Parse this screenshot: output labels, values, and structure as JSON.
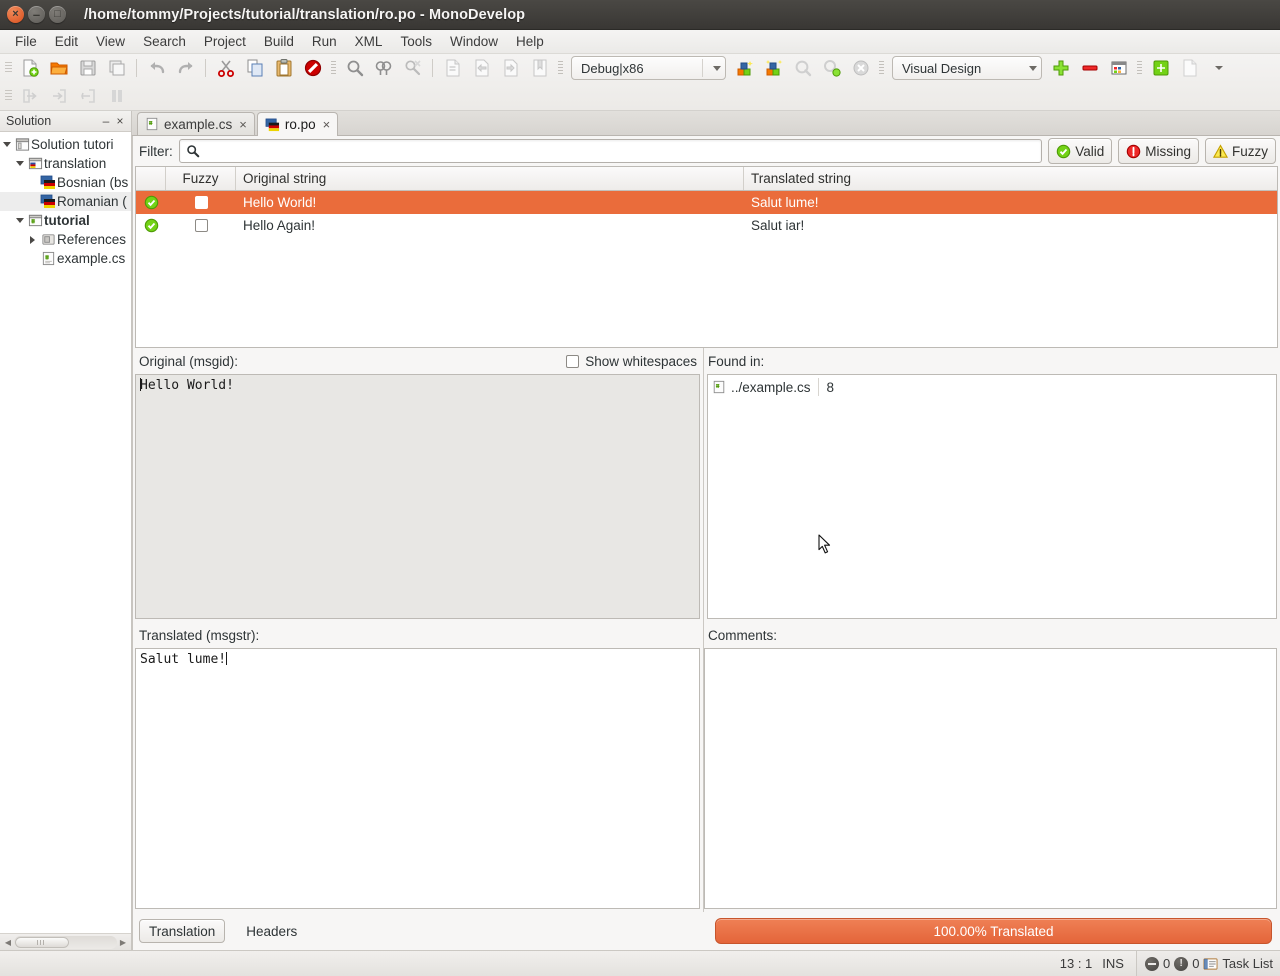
{
  "window": {
    "title": "/home/tommy/Projects/tutorial/translation/ro.po - MonoDevelop",
    "close_label": "×",
    "minimize_label": "–",
    "maximize_label": "□"
  },
  "menubar": {
    "items": [
      "File",
      "Edit",
      "View",
      "Search",
      "Project",
      "Build",
      "Run",
      "XML",
      "Tools",
      "Window",
      "Help"
    ]
  },
  "toolbar": {
    "icons_row1": [
      "new-file-icon",
      "open-file-icon",
      "save-icon",
      "save-all-icon",
      "undo-icon",
      "redo-icon",
      "cut-icon",
      "copy-icon",
      "paste-icon",
      "stop-icon",
      "find-icon",
      "find-replace-icon",
      "clear-search-icon",
      "comment-icon",
      "uncomment-icon",
      "indent-icon",
      "bookmark-icon"
    ],
    "icons_row2": [
      "step-out-icon",
      "step-over-icon",
      "step-into-icon",
      "pause-icon"
    ],
    "configuration": "Debug|x86",
    "build_icons": [
      "build-icon",
      "rebuild-icon",
      "run-icon",
      "run-with-icon",
      "stop-debug-icon"
    ],
    "view_mode": "Visual Design",
    "right_icons": [
      "add-icon",
      "remove-icon",
      "grid-icon",
      "properties-icon",
      "document-outline-icon",
      "overflow-arrow-icon"
    ]
  },
  "sidebar": {
    "title": "Solution",
    "minimize_label": "–",
    "close_label": "×",
    "items": [
      {
        "label": "Solution tutori",
        "icon": "solution-icon",
        "indent": 0,
        "expander": "open",
        "bold": false,
        "selected": false
      },
      {
        "label": "translation",
        "icon": "translation-project-icon",
        "indent": 1,
        "expander": "open",
        "bold": false,
        "selected": false
      },
      {
        "label": "Bosnian (bs",
        "icon": "flag-icon",
        "indent": 2,
        "expander": "none",
        "bold": false,
        "selected": false
      },
      {
        "label": "Romanian (",
        "icon": "flag-icon",
        "indent": 2,
        "expander": "none",
        "bold": false,
        "selected": true
      },
      {
        "label": "tutorial",
        "icon": "csharp-project-icon",
        "indent": 1,
        "expander": "open",
        "bold": true,
        "selected": false
      },
      {
        "label": "References",
        "icon": "references-icon",
        "indent": 2,
        "expander": "closed",
        "bold": false,
        "selected": false
      },
      {
        "label": "example.cs",
        "icon": "csharp-file-icon",
        "indent": 2,
        "expander": "none",
        "bold": false,
        "selected": false
      }
    ]
  },
  "tabs": [
    {
      "label": "example.cs",
      "icon": "csharp-file-icon",
      "active": false,
      "close": "×"
    },
    {
      "label": "ro.po",
      "icon": "flag-icon",
      "active": true,
      "close": "×"
    }
  ],
  "filter": {
    "label": "Filter:",
    "value": "",
    "placeholder": "",
    "search_icon": "search-icon",
    "buttons": [
      {
        "label": "Valid",
        "icon": "valid-icon",
        "color": "#4e9a06"
      },
      {
        "label": "Missing",
        "icon": "missing-icon",
        "color": "#cc0000"
      },
      {
        "label": "Fuzzy",
        "icon": "fuzzy-icon",
        "color": "#edd400"
      }
    ]
  },
  "table": {
    "columns": [
      "",
      "Fuzzy",
      "Original string",
      "Translated string"
    ],
    "rows": [
      {
        "status": "valid",
        "fuzzy": false,
        "original": "Hello World!",
        "translated": "Salut lume!",
        "selected": true
      },
      {
        "status": "valid",
        "fuzzy": false,
        "original": "Hello Again!",
        "translated": "Salut iar!",
        "selected": false
      }
    ]
  },
  "panes": {
    "original_label": "Original (msgid):",
    "original_value": "Hello World!",
    "show_whitespaces_label": "Show whitespaces",
    "show_whitespaces_checked": false,
    "found_in_label": "Found in:",
    "found_in": [
      {
        "file": "../example.cs",
        "line": "8",
        "icon": "csharp-file-icon"
      }
    ],
    "translated_label": "Translated (msgstr):",
    "translated_value": "Salut lume!",
    "comments_label": "Comments:",
    "comments_value": ""
  },
  "bottom": {
    "tabs": [
      {
        "label": "Translation",
        "active": true
      },
      {
        "label": "Headers",
        "active": false
      }
    ],
    "progress_text": "100.00% Translated",
    "progress_percent": 100,
    "progress_color": "#e4653a"
  },
  "statusbar": {
    "position": "13 : 1",
    "insert_mode": "INS",
    "errors": "0",
    "warnings": "0",
    "task_list_label": "Task List",
    "task_list_icon": "task-list-icon"
  },
  "colors": {
    "selection_orange": "#ea6c3b",
    "titlebar": "#3e3c39",
    "chrome": "#f2f1f0"
  }
}
